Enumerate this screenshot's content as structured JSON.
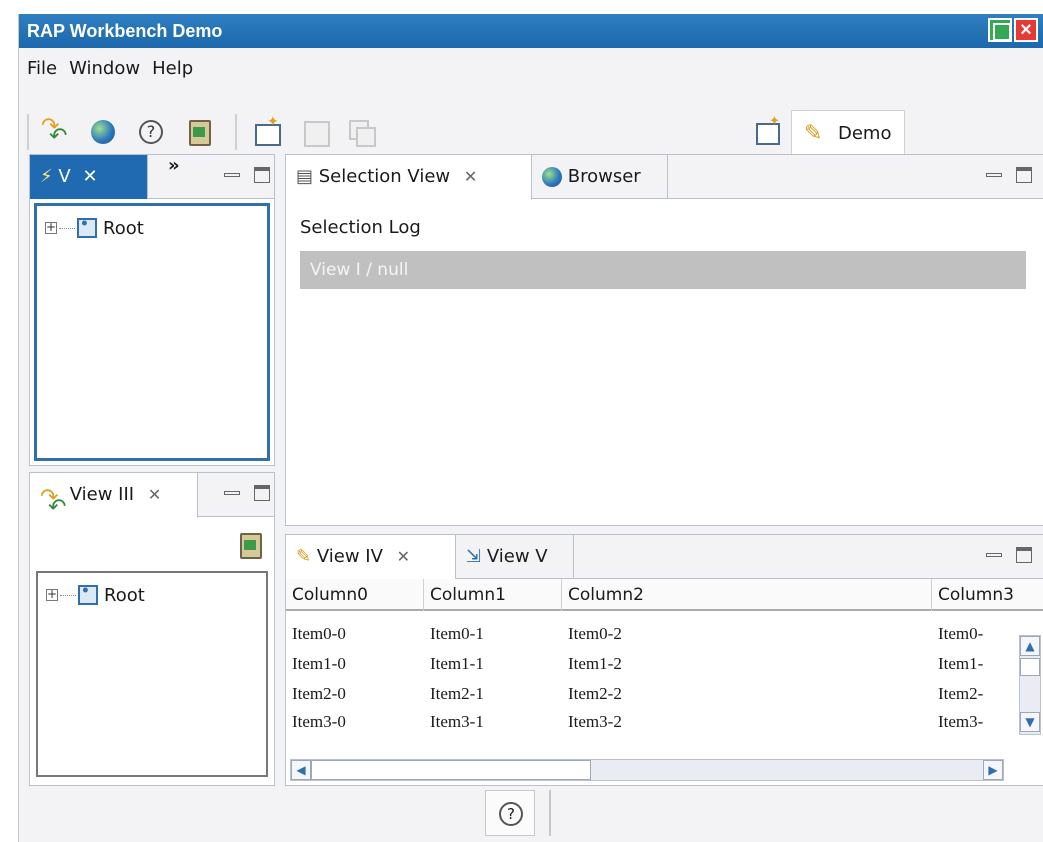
{
  "window": {
    "title": "RAP Workbench Demo"
  },
  "menu": [
    "File",
    "Window",
    "Help"
  ],
  "perspective": {
    "label": "Demo"
  },
  "top_left_panel": {
    "tab_label": "V",
    "chevron": "»",
    "tree": {
      "root_label": "Root"
    }
  },
  "view3_panel": {
    "tab_label": "View III",
    "tree": {
      "root_label": "Root"
    }
  },
  "selection_panel": {
    "tabs": [
      {
        "label": "Selection View"
      },
      {
        "label": "Browser"
      }
    ],
    "log_label": "Selection Log",
    "log_entry": "View I / null"
  },
  "table_panel": {
    "tabs": [
      {
        "label": "View IV"
      },
      {
        "label": "View V"
      }
    ],
    "columns": [
      "Column0",
      "Column1",
      "Column2",
      "Column3"
    ],
    "rows": [
      [
        "Item0-0",
        "Item0-1",
        "Item0-2",
        "Item0-"
      ],
      [
        "Item1-0",
        "Item1-1",
        "Item1-2",
        "Item1-"
      ],
      [
        "Item2-0",
        "Item2-1",
        "Item2-2",
        "Item2-"
      ],
      [
        "Item3-0",
        "Item3-1",
        "Item3-2",
        "Item3-"
      ]
    ]
  },
  "colors": {
    "titlebar": "#1f6ab0",
    "active_tab": "#1f6ab0",
    "log_highlight": "#c0c0c0"
  },
  "icons": {
    "toolbar": [
      "refresh-arrows-icon",
      "globe-icon",
      "help-icon",
      "clipboard-icon",
      "new-folder-icon",
      "save-icon",
      "save-all-icon"
    ],
    "perspective": [
      "open-perspective-icon",
      "feather-icon"
    ]
  }
}
